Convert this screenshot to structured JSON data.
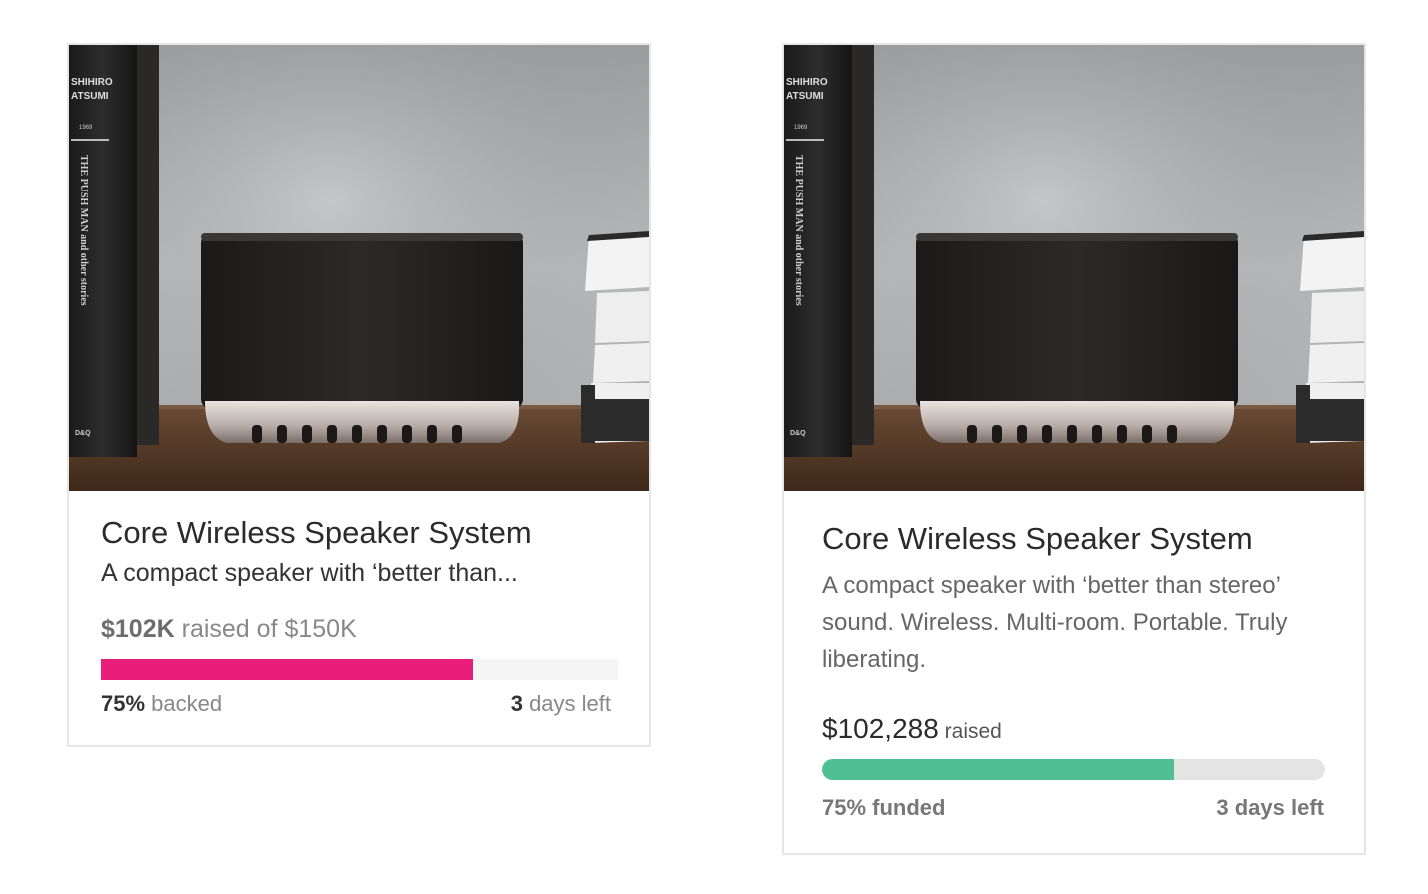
{
  "cards": [
    {
      "title": "Core Wireless Speaker System",
      "description": "A compact speaker with ‘better than...",
      "raised_amount": "$102K",
      "raised_text": "raised of",
      "goal": "$150K",
      "progress_fraction": 0.72,
      "percent": "75%",
      "percent_label": "backed",
      "days": "3",
      "days_label": "days left",
      "bar_color": "#e91e7a"
    },
    {
      "title": "Core Wireless Speaker System",
      "description": "A compact speaker with ‘better than stereo’ sound. Wireless. Multi-room. Portable. Truly liberating.",
      "raised_amount": "$102,288",
      "raised_text": "raised",
      "progress_fraction": 0.7,
      "funded_label": "75% funded",
      "days_left_label": "3 days left",
      "bar_color": "#4fbf94"
    }
  ],
  "image_text": {
    "spine_author": "OSHIHIRO ATSUMI",
    "spine_year": "1969",
    "spine_title": "THE PUSH MAN and other stories",
    "spine_publisher": "D&Q"
  }
}
